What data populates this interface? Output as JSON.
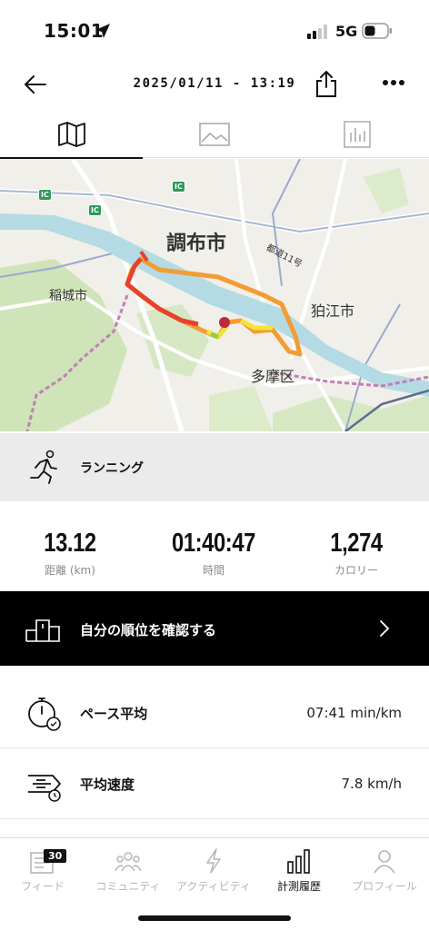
{
  "status_bar": {
    "time": "15:01",
    "network": "5G",
    "location_icon": "location-arrow-icon",
    "battery_icon": "battery-icon"
  },
  "nav": {
    "datetime": "2025/01/11 - 13:19",
    "back_icon": "arrow-left-icon",
    "share_icon": "share-icon",
    "more_icon": "more-dots-icon"
  },
  "tabs": [
    {
      "icon": "map-icon",
      "active": true
    },
    {
      "icon": "image-icon",
      "active": false
    },
    {
      "icon": "bar-chart-icon",
      "active": false
    }
  ],
  "map": {
    "labels": {
      "chofu": "調布市",
      "inagi": "稲城市",
      "komae": "狛江市",
      "tama": "多摩区",
      "road": "都道11号",
      "ic": "IC"
    },
    "route_colors": [
      "#f39c33",
      "#e8412c",
      "#f5e33a",
      "#8dcf3f"
    ]
  },
  "activity": {
    "label": "ランニング",
    "icon": "running-person-icon"
  },
  "stats": {
    "distance": {
      "value": "13.12",
      "label": "距離 (km)"
    },
    "time": {
      "value": "01:40:47",
      "label": "時間"
    },
    "calories": {
      "value": "1,274",
      "label": "カロリー"
    }
  },
  "rank": {
    "label": "自分の順位を確認する",
    "icon": "podium-icon",
    "chevron_icon": "chevron-right-icon"
  },
  "metrics": [
    {
      "label": "ペース平均",
      "value": "07:41 min/km",
      "icon": "stopwatch-icon"
    },
    {
      "label": "平均速度",
      "value": "7.8 km/h",
      "icon": "speed-lines-icon"
    }
  ],
  "bottom_nav": {
    "items": [
      {
        "label": "フィード",
        "icon": "feed-icon",
        "badge": "30"
      },
      {
        "label": "コミュニティ",
        "icon": "community-icon"
      },
      {
        "label": "アクティビティ",
        "icon": "lightning-icon"
      },
      {
        "label": "計測履歴",
        "icon": "history-bars-icon",
        "active": true
      },
      {
        "label": "プロフィール",
        "icon": "profile-icon"
      }
    ]
  }
}
